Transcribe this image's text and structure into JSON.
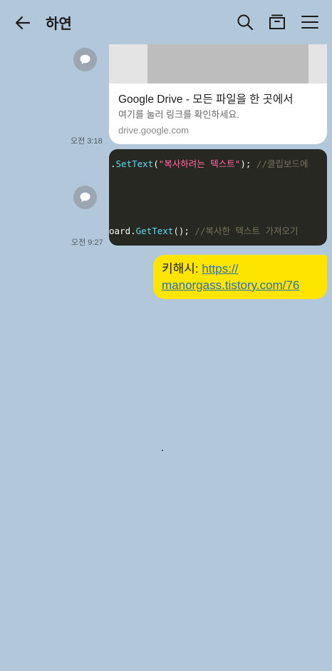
{
  "header": {
    "title": "하연",
    "icons": [
      "back-arrow-icon",
      "search-icon",
      "drawer-icon",
      "menu-icon"
    ]
  },
  "messages": [
    {
      "type": "link-preview",
      "title": "Google Drive - 모든 파일을 한 곳에서",
      "description": "여기를 눌러 링크를 확인하세요.",
      "domain": "drive.google.com",
      "time": "오전 3:18"
    },
    {
      "type": "code-image",
      "line1": {
        "dot": ".",
        "fn": "SetText",
        "open": "(",
        "str": "\"복사하려는 텍스트\"",
        "close": ");",
        "comment": " //클립보드에"
      },
      "line2": {
        "prefix": "oard.",
        "fn": "GetText",
        "call": "();",
        "comment": " //복사한 텍스트 가져오기"
      },
      "time": "오전 9:27"
    },
    {
      "type": "sent-text",
      "prefix": "키해시: ",
      "link_line1": "https://",
      "link_line2": "manorgass.tistory.com/76"
    }
  ],
  "colors": {
    "background": "#b2c7d9",
    "my_bubble": "#fee500",
    "link": "#2f6fb3"
  }
}
